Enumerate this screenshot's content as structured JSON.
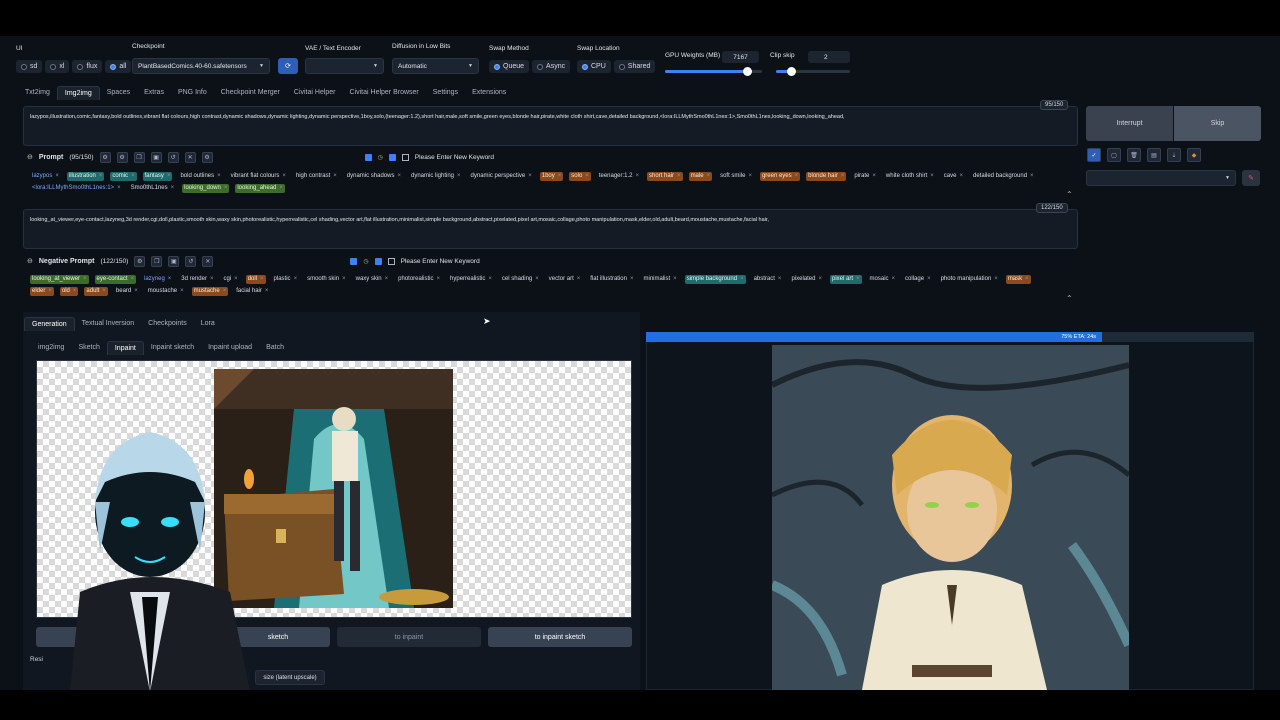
{
  "ui": {
    "label": "UI",
    "options": [
      "sd",
      "xl",
      "flux",
      "all"
    ],
    "selected": "all"
  },
  "checkpoint": {
    "label": "Checkpoint",
    "value": "PlantBasedComics.40-60.safetensors"
  },
  "vae": {
    "label": "VAE / Text Encoder",
    "value": ""
  },
  "diffusion": {
    "label": "Diffusion in Low Bits",
    "value": "Automatic"
  },
  "swap_method": {
    "label": "Swap Method",
    "options": [
      "Queue",
      "Async"
    ],
    "selected": "Queue"
  },
  "swap_location": {
    "label": "Swap Location",
    "options": [
      "CPU",
      "Shared"
    ],
    "selected": "CPU"
  },
  "gpu_weights": {
    "label": "GPU Weights (MB)",
    "value": "7167",
    "fraction": 0.85
  },
  "clip_skip": {
    "label": "Clip skip",
    "value": "2",
    "fraction": 0.2
  },
  "main_tabs": [
    "Txt2img",
    "Img2img",
    "Spaces",
    "Extras",
    "PNG Info",
    "Checkpoint Merger",
    "Civitai Helper",
    "Civitai Helper Browser",
    "Settings",
    "Extensions"
  ],
  "main_tab_active": "Img2img",
  "prompt": {
    "text": "lazypos,illustration,comic,fantasy,bold outlines,vibrant flat colours,high contrast,dynamic shadows,dynamic lighting,dynamic perspective,1boy,solo,(teenager:1.2),short hair,male,soft smile,green eyes,blonde hair,pirate,white cloth shirt,cave,detailed background,<lora:ILLMythSmo0thL1nes:1>,Smo0thL1nes,looking_down,looking_ahead,",
    "counter": "95/150",
    "title": "Prompt",
    "title_count": "(95/150)",
    "keyword_placeholder": "Please Enter New Keyword",
    "tags": [
      {
        "t": "lazypos",
        "c": "blue"
      },
      {
        "t": "illustration",
        "c": "teal"
      },
      {
        "t": "comic",
        "c": "teal"
      },
      {
        "t": "fantasy",
        "c": "teal"
      },
      {
        "t": "bold outlines",
        "c": "none"
      },
      {
        "t": "vibrant flat colours",
        "c": "none"
      },
      {
        "t": "high contrast",
        "c": "none"
      },
      {
        "t": "dynamic shadows",
        "c": "none"
      },
      {
        "t": "dynamic lighting",
        "c": "none"
      },
      {
        "t": "dynamic perspective",
        "c": "none"
      },
      {
        "t": "1boy",
        "c": "orange"
      },
      {
        "t": "solo",
        "c": "orange"
      },
      {
        "t": "teenager:1.2",
        "c": "none"
      },
      {
        "t": "short hair",
        "c": "orange"
      },
      {
        "t": "male",
        "c": "orange"
      },
      {
        "t": "soft smile",
        "c": "none"
      },
      {
        "t": "green eyes",
        "c": "orange"
      },
      {
        "t": "blonde hair",
        "c": "orange"
      },
      {
        "t": "pirate",
        "c": "none"
      },
      {
        "t": "white cloth shirt",
        "c": "none"
      },
      {
        "t": "cave",
        "c": "none"
      },
      {
        "t": "detailed background",
        "c": "none"
      },
      {
        "t": "<lora:ILLMythSmo0thL1nes:1>",
        "c": "blue"
      },
      {
        "t": "Smo0thL1nes",
        "c": "none"
      },
      {
        "t": "looking_down",
        "c": "green"
      },
      {
        "t": "looking_ahead",
        "c": "green"
      }
    ]
  },
  "negative": {
    "text": "looking_at_viewer,eye-contact,lazyneg,3d render,cgi,doll,plastic,smooth skin,waxy skin,photorealistic,hyperrealistic,cel shading,vector art,flat illustration,minimalist,simple background,abstract,pixelated,pixel art,mosaic,collage,photo manipulation,mask,elder,old,adult,beard,moustache,mustache,facial hair,",
    "counter": "122/150",
    "title": "Negative Prompt",
    "title_count": "(122/150)",
    "keyword_placeholder": "Please Enter New Keyword",
    "tags": [
      {
        "t": "looking_at_viewer",
        "c": "green"
      },
      {
        "t": "eye-contact",
        "c": "green"
      },
      {
        "t": "lazyneg",
        "c": "blue"
      },
      {
        "t": "3d render",
        "c": "none"
      },
      {
        "t": "cgi",
        "c": "none"
      },
      {
        "t": "doll",
        "c": "orange"
      },
      {
        "t": "plastic",
        "c": "none"
      },
      {
        "t": "smooth skin",
        "c": "none"
      },
      {
        "t": "waxy skin",
        "c": "none"
      },
      {
        "t": "photorealistic",
        "c": "none"
      },
      {
        "t": "hyperrealistic",
        "c": "none"
      },
      {
        "t": "cel shading",
        "c": "none"
      },
      {
        "t": "vector art",
        "c": "none"
      },
      {
        "t": "flat illustration",
        "c": "none"
      },
      {
        "t": "minimalist",
        "c": "none"
      },
      {
        "t": "simple background",
        "c": "teal"
      },
      {
        "t": "abstract",
        "c": "none"
      },
      {
        "t": "pixelated",
        "c": "none"
      },
      {
        "t": "pixel art",
        "c": "teal"
      },
      {
        "t": "mosaic",
        "c": "none"
      },
      {
        "t": "collage",
        "c": "none"
      },
      {
        "t": "photo manipulation",
        "c": "none"
      },
      {
        "t": "mask",
        "c": "orange"
      },
      {
        "t": "elder",
        "c": "orange"
      },
      {
        "t": "old",
        "c": "orange"
      },
      {
        "t": "adult",
        "c": "orange"
      },
      {
        "t": "beard",
        "c": "none"
      },
      {
        "t": "moustache",
        "c": "none"
      },
      {
        "t": "mustache",
        "c": "orange"
      },
      {
        "t": "facial hair",
        "c": "none"
      }
    ]
  },
  "actions": {
    "interrupt": "Interrupt",
    "skip": "Skip"
  },
  "gen_tabs": [
    "Generation",
    "Textual Inversion",
    "Checkpoints",
    "Lora"
  ],
  "gen_tab_active": "Generation",
  "img_tabs": [
    "img2img",
    "Sketch",
    "Inpaint",
    "Inpaint sketch",
    "Inpaint upload",
    "Batch"
  ],
  "img_tab_active": "Inpaint",
  "copy_buttons": [
    "sketch",
    "to inpaint",
    "to inpaint sketch"
  ],
  "resize_partial": "Resi",
  "latent_upscale": "size (latent upscale)",
  "progress": {
    "label": "75% ETA: 24s",
    "fraction": 0.75
  },
  "colors": {
    "accent": "#3b82f6",
    "bg": "#0c1118",
    "progress": "#1f6fe0"
  }
}
